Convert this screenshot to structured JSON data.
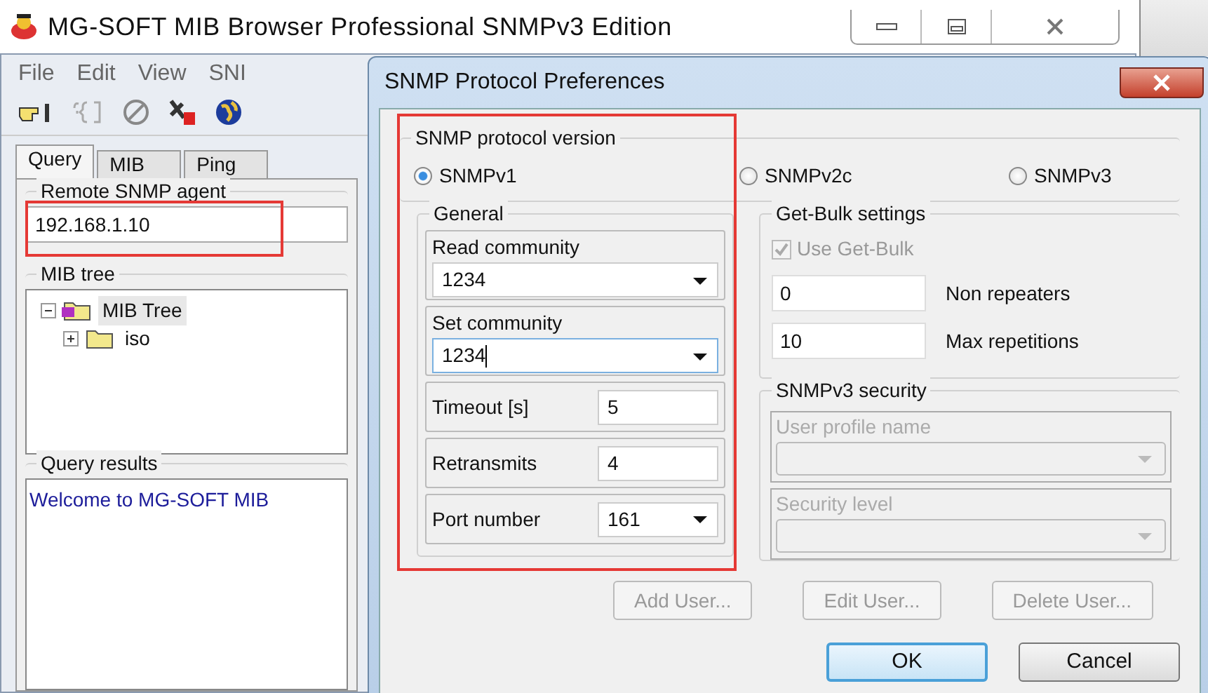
{
  "app": {
    "title": "MG-SOFT MIB Browser Professional SNMPv3 Edition",
    "menu": [
      "File",
      "Edit",
      "View",
      "SNI"
    ],
    "tabs": [
      {
        "label": "Query",
        "selected": true
      },
      {
        "label": "MIB",
        "selected": false
      },
      {
        "label": "Ping",
        "selected": false
      }
    ],
    "remote_agent": {
      "label": "Remote SNMP agent",
      "value": "192.168.1.10",
      "highlighted": true
    },
    "mib_tree": {
      "label": "MIB tree",
      "items": [
        {
          "label": "MIB Tree",
          "expanded": true,
          "selected": true,
          "children": [
            {
              "label": "iso",
              "expanded": false,
              "selected": false
            }
          ]
        }
      ]
    },
    "query_results": {
      "label": "Query results",
      "text": "Welcome to MG-SOFT MIB"
    }
  },
  "dialog": {
    "title": "SNMP Protocol Preferences",
    "highlighted": true,
    "protocol_version": {
      "label": "SNMP protocol version",
      "options": [
        {
          "label": "SNMPv1",
          "selected": true
        },
        {
          "label": "SNMPv2c",
          "selected": false
        },
        {
          "label": "SNMPv3",
          "selected": false
        }
      ]
    },
    "general": {
      "label": "General",
      "fields": [
        {
          "kind": "combo",
          "label": "Read community",
          "value": "1234",
          "focused": false
        },
        {
          "kind": "combo",
          "label": "Set community",
          "value": "1234",
          "focused": true
        },
        {
          "kind": "text",
          "label": "Timeout [s]",
          "value": "5"
        },
        {
          "kind": "text",
          "label": "Retransmits",
          "value": "4"
        },
        {
          "kind": "combo-inline",
          "label": "Port number",
          "value": "161"
        }
      ]
    },
    "get_bulk": {
      "label": "Get-Bulk settings",
      "use_get_bulk": {
        "label": "Use Get-Bulk",
        "checked": true,
        "disabled": true
      },
      "fields": [
        {
          "label": "Non repeaters",
          "value": "0"
        },
        {
          "label": "Max repetitions",
          "value": "10"
        }
      ]
    },
    "v3_security": {
      "label": "SNMPv3 security",
      "fields": [
        {
          "label": "User profile name",
          "disabled": true
        },
        {
          "label": "Security level",
          "disabled": true
        }
      ]
    },
    "user_buttons": [
      {
        "label": "Add User...",
        "disabled": true
      },
      {
        "label": "Edit User...",
        "disabled": true
      },
      {
        "label": "Delete User...",
        "disabled": true
      }
    ],
    "buttons": [
      {
        "label": "OK",
        "default": true
      },
      {
        "label": "Cancel",
        "default": false
      }
    ]
  }
}
